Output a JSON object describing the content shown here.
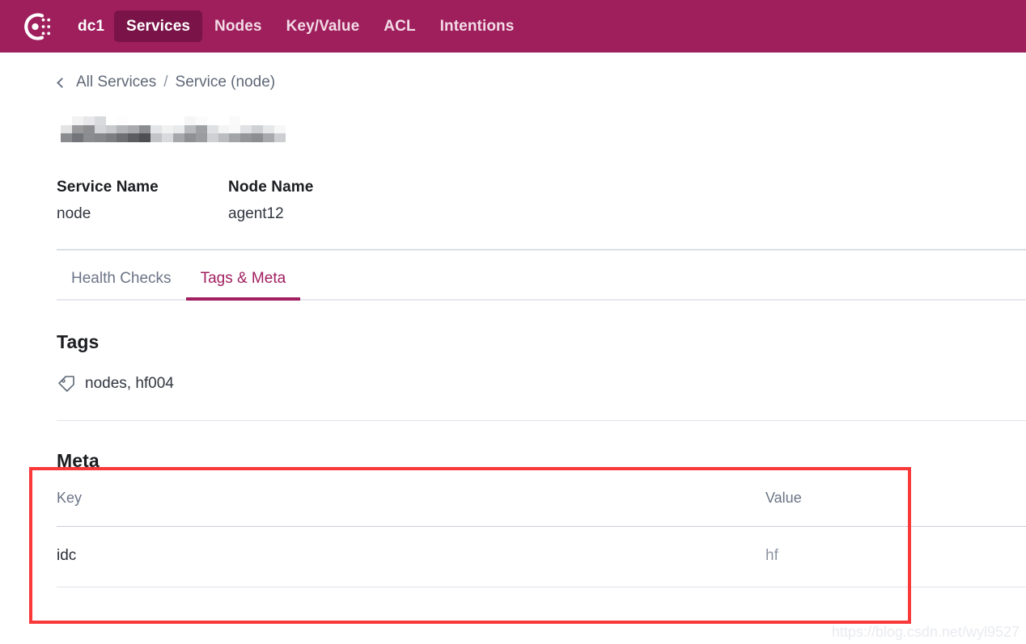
{
  "navbar": {
    "logo_icon": "consul-logo-icon",
    "datacenter": "dc1",
    "items": [
      {
        "label": "Services",
        "active": true
      },
      {
        "label": "Nodes",
        "active": false
      },
      {
        "label": "Key/Value",
        "active": false
      },
      {
        "label": "ACL",
        "active": false
      },
      {
        "label": "Intentions",
        "active": false
      }
    ],
    "background_color": "#9e1f5c",
    "active_pill_color": "#7a1348"
  },
  "breadcrumb": {
    "back_icon": "chevron-left-icon",
    "parent": "All Services",
    "separator": "/",
    "current": "Service (node)"
  },
  "page_title": {
    "text": "",
    "redacted": true,
    "note": "pixelated / mosaic redaction"
  },
  "fields": [
    {
      "label": "Service Name",
      "value": "node"
    },
    {
      "label": "Node Name",
      "value": "agent12"
    }
  ],
  "tabs": [
    {
      "label": "Health Checks",
      "active": false
    },
    {
      "label": "Tags & Meta",
      "active": true
    }
  ],
  "tags_section": {
    "title": "Tags",
    "icon": "tag-icon",
    "value": "nodes, hf004"
  },
  "meta_section": {
    "title": "Meta",
    "columns": [
      "Key",
      "Value"
    ],
    "rows": [
      {
        "key": "idc",
        "value": "hf"
      }
    ]
  },
  "annotation": {
    "shape": "rectangle",
    "color": "#f9383a"
  },
  "watermark": {
    "text": "https://blog.csdn.net/wyl9527"
  }
}
